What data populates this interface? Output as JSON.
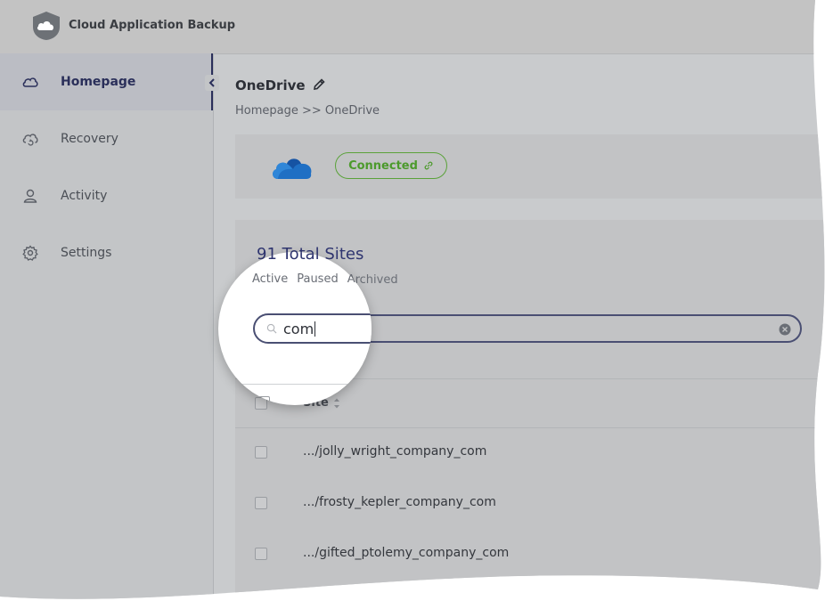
{
  "app": {
    "title": "Cloud Application Backup"
  },
  "sidebar": {
    "items": [
      {
        "label": "Homepage",
        "icon": "cloud-icon",
        "active": true
      },
      {
        "label": "Recovery",
        "icon": "cloud-restore-icon",
        "active": false
      },
      {
        "label": "Activity",
        "icon": "user-icon",
        "active": false
      },
      {
        "label": "Settings",
        "icon": "gear-icon",
        "active": false
      }
    ]
  },
  "header": {
    "title": "OneDrive",
    "breadcrumb": "Homepage >> OneDrive"
  },
  "connection": {
    "status_label": "Connected",
    "status_color": "#4c9a2c"
  },
  "sites": {
    "total_label": "91 Total Sites",
    "filters": [
      "Active",
      "Paused",
      "Archived"
    ],
    "search": {
      "value": "com"
    },
    "column_site": "Site",
    "rows": [
      {
        "site": ".../jolly_wright_company_com"
      },
      {
        "site": ".../frosty_kepler_company_com"
      },
      {
        "site": ".../gifted_ptolemy_company_com"
      }
    ]
  },
  "colors": {
    "accent": "#2a2f5a",
    "onedrive_blue": "#1f6fc4"
  }
}
